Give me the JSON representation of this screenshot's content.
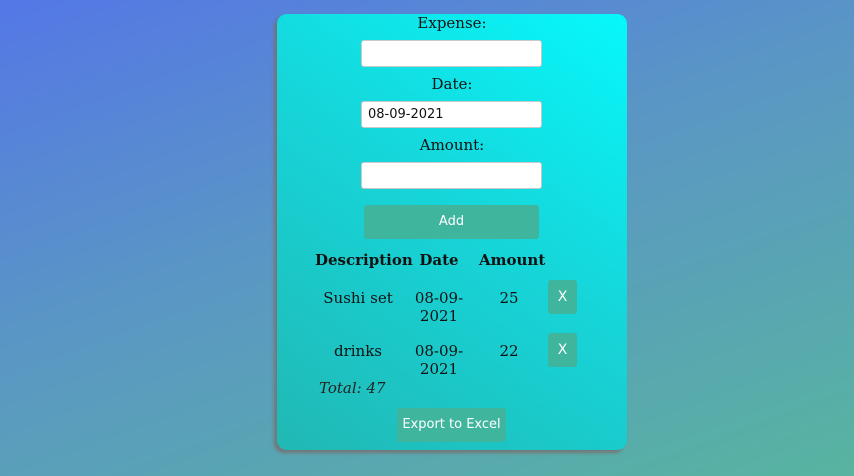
{
  "form": {
    "expense_label": "Expense:",
    "expense_value": "",
    "date_label": "Date:",
    "date_value": "08-09-2021",
    "amount_label": "Amount:",
    "amount_value": "",
    "add_label": "Add"
  },
  "table": {
    "headers": [
      "Description",
      "Date",
      "Amount"
    ],
    "rows": [
      {
        "description": "Sushi set",
        "date": "08-09-2021",
        "amount": "25",
        "delete_label": "X"
      },
      {
        "description": "drinks",
        "date": "08-09-2021",
        "amount": "22",
        "delete_label": "X"
      }
    ]
  },
  "total_label": "Total: 47",
  "export_label": "Export to Excel",
  "colors": {
    "button": "#40b59d",
    "card_top": "#06f8fb",
    "card_bottom": "#21b8b4"
  }
}
